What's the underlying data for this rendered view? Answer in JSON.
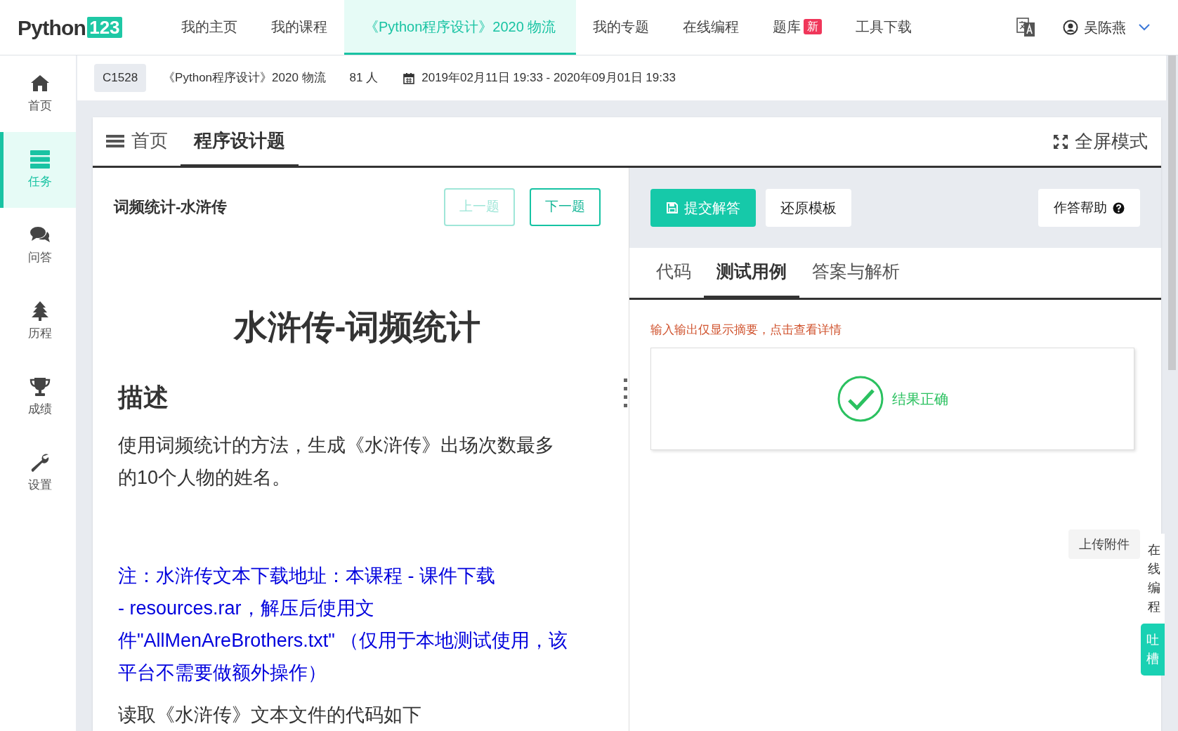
{
  "header": {
    "logo": {
      "text": "Python",
      "badge": "123"
    },
    "nav": [
      {
        "label": "我的主页",
        "selected": false
      },
      {
        "label": "我的课程",
        "selected": false
      },
      {
        "label": "《Python程序设计》2020 物流",
        "selected": true
      },
      {
        "label": "我的专题",
        "selected": false
      },
      {
        "label": "在线编程",
        "selected": false
      },
      {
        "label": "题库",
        "badge": "新",
        "selected": false
      },
      {
        "label": "工具下载",
        "selected": false
      }
    ],
    "user": "吴陈燕"
  },
  "sidebar": [
    {
      "label": "首页",
      "selected": false
    },
    {
      "label": "任务",
      "selected": true
    },
    {
      "label": "问答",
      "selected": false
    },
    {
      "label": "历程",
      "selected": false
    },
    {
      "label": "成绩",
      "selected": false
    },
    {
      "label": "设置",
      "selected": false
    }
  ],
  "course_bar": {
    "code": "C1528",
    "name": "《Python程序设计》2020 物流",
    "members": "81 人",
    "period": "2019年02月11日 19:33 - 2020年09月01日 19:33"
  },
  "card_tabs": [
    {
      "label": "首页",
      "selected": false
    },
    {
      "label": "程序设计题",
      "selected": true
    }
  ],
  "fullscreen": "全屏模式",
  "problem": {
    "title": "词频统计-水浒传",
    "nav_buttons": [
      {
        "label": "上一题",
        "disabled": true
      },
      {
        "label": "下一题",
        "disabled": false
      }
    ],
    "heading": "水浒传-词频统计",
    "section": "描述",
    "paragraph": "使用词频统计的方法，生成《水浒传》出场次数最多的10个人物的姓名。",
    "note_lines": [
      "注：水浒传文本下载地址：本课程 - 课件下载",
      "- resources.rar，解压后使用文",
      "件\"AllMenAreBrothers.txt\" （仅用于本地测试使用，该",
      "平台不需要做额外操作）"
    ],
    "cut_line": "读取《水浒传》文本文件的代码如下"
  },
  "toolbar": {
    "submit": "提交解答",
    "reset": "还原模板",
    "help": "作答帮助"
  },
  "answer_tabs": [
    {
      "label": "代码",
      "selected": false
    },
    {
      "label": "测试用例",
      "selected": true
    },
    {
      "label": "答案与解析",
      "selected": false
    }
  ],
  "notice": "输入输出仅显示摘要，点击查看详情",
  "result": "结果正确",
  "upload": "上传附件",
  "side_tabs": [
    {
      "label": "在线编程",
      "kind": "plain"
    },
    {
      "label": "吐槽",
      "kind": "accent"
    }
  ]
}
